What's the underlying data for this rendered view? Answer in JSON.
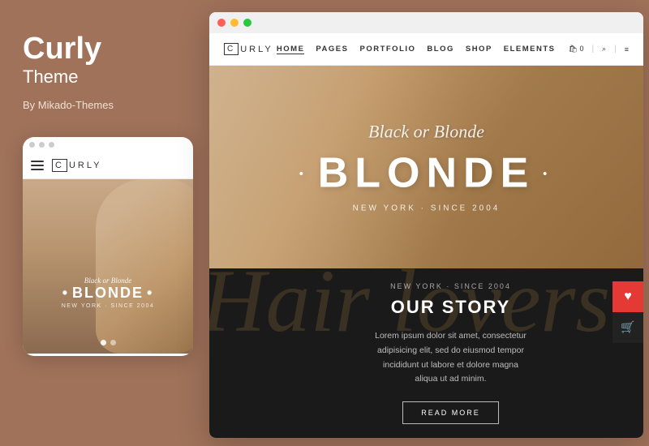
{
  "app": {
    "title": "Curly",
    "subtitle": "Theme",
    "author": "By Mikado-Themes"
  },
  "mobile": {
    "logo_c": "C",
    "logo_text": "URLY",
    "hero_italic": "Black or Blonde",
    "hero_blonde": "BLONDE",
    "hero_since": "NEW YORK · SINCE 2004"
  },
  "desktop": {
    "window_dots": [
      "dot1",
      "dot2",
      "dot3"
    ],
    "logo_c": "C",
    "logo_text": "URLY",
    "nav": {
      "links": [
        "HOME",
        "PAGES",
        "PORTFOLIO",
        "BLOG",
        "SHOP",
        "ELEMENTS"
      ],
      "active": "HOME"
    },
    "hero": {
      "italic_text": "Black or Blonde",
      "blonde_text": "BLONDE",
      "since_text": "NEW YORK · SINCE 2004"
    },
    "story": {
      "bg_text": "Hair lovers",
      "since_text": "NEW YORK · SINCE 2004",
      "title": "OUR STORY",
      "body": "Lorem ipsum dolor sit amet, consectetur adipisicing elit, sed do eiusmod tempor incididunt ut labore et dolore magna aliqua ut ad minim.",
      "button": "READ MORE"
    }
  },
  "icons": {
    "cart_text": "0",
    "search_unicode": "⌕",
    "menu_unicode": "≡",
    "floating_heart": "♥",
    "floating_cart": "🛒"
  },
  "colors": {
    "background": "#a0725a",
    "hero_bg": "#b8956e",
    "story_bg": "#1a1a1a",
    "accent_red": "#e53935"
  }
}
